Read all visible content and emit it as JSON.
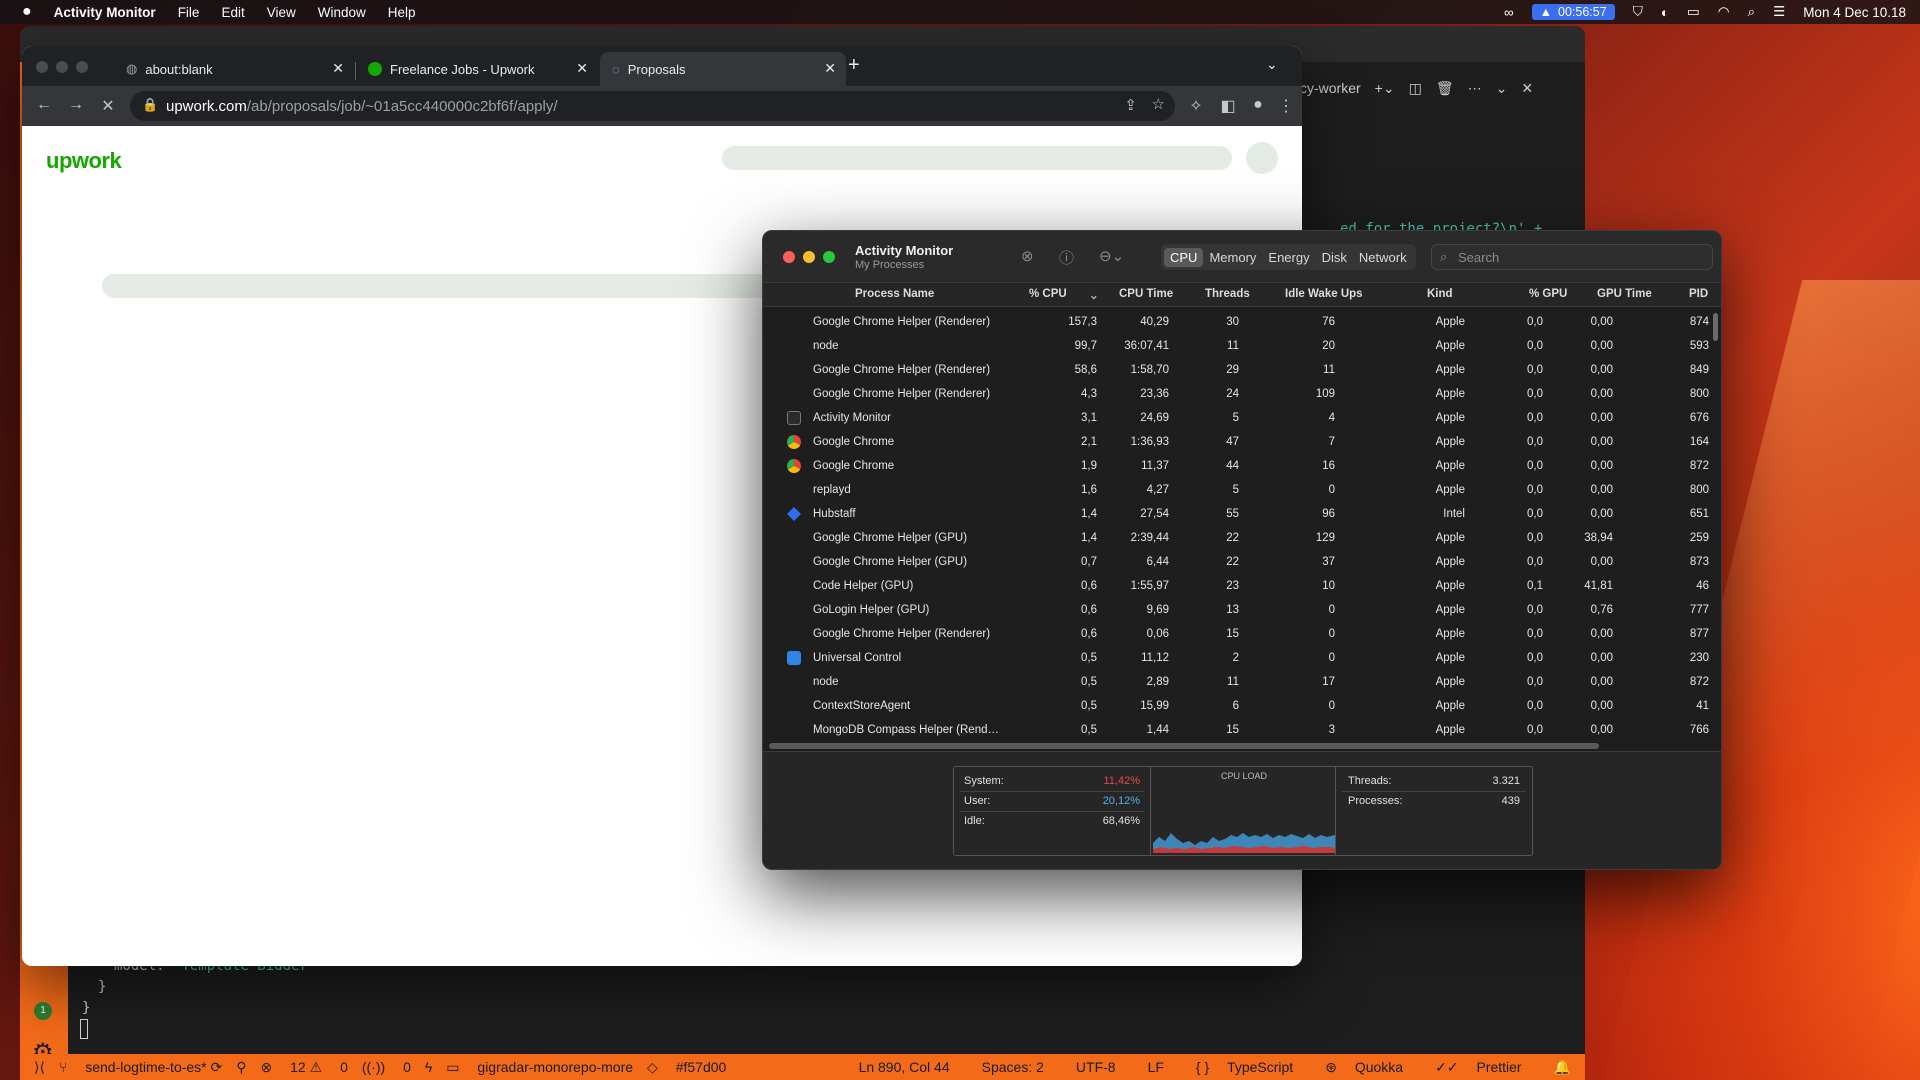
{
  "menubar": {
    "app_name": "Activity Monitor",
    "menus": [
      "File",
      "Edit",
      "View",
      "Window",
      "Help"
    ],
    "timer": "00:56:57",
    "datetime": "Mon 4 Dec  10.18"
  },
  "chrome": {
    "tabs": [
      {
        "title": "about:blank",
        "icon": "globe-icon"
      },
      {
        "title": "Freelance Jobs - Upwork",
        "icon": "upwork-icon"
      },
      {
        "title": "Proposals",
        "icon": "loading-icon"
      }
    ],
    "address": {
      "domain": "upwork.com",
      "path": "/ab/proposals/job/~01a5cc440000c2bf6f/apply/"
    },
    "page_logo": "upwork"
  },
  "vscode": {
    "panel_title": "cy-worker",
    "right_code": "ed for the project?\\n' +",
    "code_lines": [
      "model: 'Template Bidder'",
      "}",
      "}"
    ],
    "code_string": "'Template Bidder'",
    "code_key": "model: ",
    "badge": "1",
    "status": {
      "branch": "send-logtime-to-es*",
      "problems": "12",
      "warnings": "0",
      "ports": "0",
      "folder": "gigradar-monorepo-more",
      "commit": "#f57d00",
      "position": "Ln 890, Col 44",
      "spaces": "Spaces: 2",
      "encoding": "UTF-8",
      "eol": "LF",
      "language": "TypeScript",
      "quokka": "Quokka",
      "prettier": "Prettier"
    }
  },
  "activity_monitor": {
    "title": "Activity Monitor",
    "subtitle": "My Processes",
    "tabs": [
      "CPU",
      "Memory",
      "Energy",
      "Disk",
      "Network"
    ],
    "selected_tab": "CPU",
    "search_placeholder": "Search",
    "columns": [
      "Process Name",
      "% CPU",
      "CPU Time",
      "Threads",
      "Idle Wake Ups",
      "Kind",
      "% GPU",
      "GPU Time",
      "PID"
    ],
    "rows": [
      {
        "name": "Google Chrome Helper (Renderer)",
        "cpu": "157,3",
        "time": "40,29",
        "threads": "30",
        "idle": "76",
        "kind": "Apple",
        "gpu": "0,0",
        "gputime": "0,00",
        "pid": "874",
        "icon": ""
      },
      {
        "name": "node",
        "cpu": "99,7",
        "time": "36:07,41",
        "threads": "11",
        "idle": "20",
        "kind": "Apple",
        "gpu": "0,0",
        "gputime": "0,00",
        "pid": "593",
        "icon": ""
      },
      {
        "name": "Google Chrome Helper (Renderer)",
        "cpu": "58,6",
        "time": "1:58,70",
        "threads": "29",
        "idle": "11",
        "kind": "Apple",
        "gpu": "0,0",
        "gputime": "0,00",
        "pid": "849",
        "icon": ""
      },
      {
        "name": "Google Chrome Helper (Renderer)",
        "cpu": "4,3",
        "time": "23,36",
        "threads": "24",
        "idle": "109",
        "kind": "Apple",
        "gpu": "0,0",
        "gputime": "0,00",
        "pid": "800",
        "icon": ""
      },
      {
        "name": "Activity Monitor",
        "cpu": "3,1",
        "time": "24,69",
        "threads": "5",
        "idle": "4",
        "kind": "Apple",
        "gpu": "0,0",
        "gputime": "0,00",
        "pid": "676",
        "icon": "activity-monitor-icon"
      },
      {
        "name": "Google Chrome",
        "cpu": "2,1",
        "time": "1:36,93",
        "threads": "47",
        "idle": "7",
        "kind": "Apple",
        "gpu": "0,0",
        "gputime": "0,00",
        "pid": "164",
        "icon": "chrome-icon"
      },
      {
        "name": "Google Chrome",
        "cpu": "1,9",
        "time": "11,37",
        "threads": "44",
        "idle": "16",
        "kind": "Apple",
        "gpu": "0,0",
        "gputime": "0,00",
        "pid": "872",
        "icon": "chrome-icon"
      },
      {
        "name": "replayd",
        "cpu": "1,6",
        "time": "4,27",
        "threads": "5",
        "idle": "0",
        "kind": "Apple",
        "gpu": "0,0",
        "gputime": "0,00",
        "pid": "800",
        "icon": ""
      },
      {
        "name": "Hubstaff",
        "cpu": "1,4",
        "time": "27,54",
        "threads": "55",
        "idle": "96",
        "kind": "Intel",
        "gpu": "0,0",
        "gputime": "0,00",
        "pid": "651",
        "icon": "hubstaff-icon"
      },
      {
        "name": "Google Chrome Helper (GPU)",
        "cpu": "1,4",
        "time": "2:39,44",
        "threads": "22",
        "idle": "129",
        "kind": "Apple",
        "gpu": "0,0",
        "gputime": "38,94",
        "pid": "259",
        "icon": ""
      },
      {
        "name": "Google Chrome Helper (GPU)",
        "cpu": "0,7",
        "time": "6,44",
        "threads": "22",
        "idle": "37",
        "kind": "Apple",
        "gpu": "0,0",
        "gputime": "0,00",
        "pid": "873",
        "icon": ""
      },
      {
        "name": "Code Helper (GPU)",
        "cpu": "0,6",
        "time": "1:55,97",
        "threads": "23",
        "idle": "10",
        "kind": "Apple",
        "gpu": "0,1",
        "gputime": "41,81",
        "pid": "46",
        "icon": ""
      },
      {
        "name": "GoLogin Helper (GPU)",
        "cpu": "0,6",
        "time": "9,69",
        "threads": "13",
        "idle": "0",
        "kind": "Apple",
        "gpu": "0,0",
        "gputime": "0,76",
        "pid": "777",
        "icon": ""
      },
      {
        "name": "Google Chrome Helper (Renderer)",
        "cpu": "0,6",
        "time": "0,06",
        "threads": "15",
        "idle": "0",
        "kind": "Apple",
        "gpu": "0,0",
        "gputime": "0,00",
        "pid": "877",
        "icon": ""
      },
      {
        "name": "Universal Control",
        "cpu": "0,5",
        "time": "11,12",
        "threads": "2",
        "idle": "0",
        "kind": "Apple",
        "gpu": "0,0",
        "gputime": "0,00",
        "pid": "230",
        "icon": "universal-control-icon"
      },
      {
        "name": "node",
        "cpu": "0,5",
        "time": "2,89",
        "threads": "11",
        "idle": "17",
        "kind": "Apple",
        "gpu": "0,0",
        "gputime": "0,00",
        "pid": "872",
        "icon": ""
      },
      {
        "name": "ContextStoreAgent",
        "cpu": "0,5",
        "time": "15,99",
        "threads": "6",
        "idle": "0",
        "kind": "Apple",
        "gpu": "0,0",
        "gputime": "0,00",
        "pid": "41",
        "icon": ""
      },
      {
        "name": "MongoDB Compass Helper (Rend…",
        "cpu": "0,5",
        "time": "1,44",
        "threads": "15",
        "idle": "3",
        "kind": "Apple",
        "gpu": "0,0",
        "gputime": "0,00",
        "pid": "766",
        "icon": ""
      }
    ],
    "stats": {
      "system_label": "System:",
      "system": "11,42%",
      "user_label": "User:",
      "user": "20,12%",
      "idle_label": "Idle:",
      "idle": "68,46%",
      "cpu_load_label": "CPU LOAD",
      "threads_label": "Threads:",
      "threads": "3.321",
      "processes_label": "Processes:",
      "processes": "439"
    },
    "colors": {
      "system": "#e5484d",
      "user": "#4fb3e8"
    }
  }
}
